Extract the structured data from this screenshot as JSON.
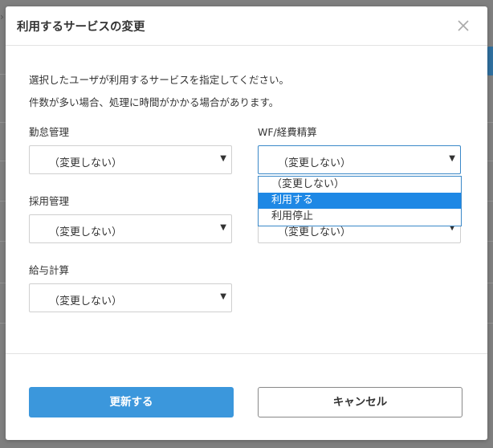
{
  "dialog": {
    "title": "利用するサービスの変更",
    "description_line1": "選択したユーザが利用するサービスを指定してください。",
    "description_line2": "件数が多い場合、処理に時間がかかる場合があります。"
  },
  "fields": {
    "attendance": {
      "label": "勤怠管理",
      "value": "（変更しない）"
    },
    "recruitment": {
      "label": "採用管理",
      "value": "（変更しない）"
    },
    "payroll": {
      "label": "給与計算",
      "value": "（変更しない）"
    },
    "wf_expense": {
      "label": "WF/経費精算",
      "value": "（変更しない）"
    },
    "behind_dropdown": {
      "value": "（変更しない）"
    }
  },
  "dropdown": {
    "options": [
      "（変更しない）",
      "利用する",
      "利用停止"
    ],
    "highlighted_index": 1,
    "highlight_color": "#1e88e5"
  },
  "buttons": {
    "update_label": "更新する",
    "cancel_label": "キャンセル",
    "primary_color": "#3b97dc"
  },
  "icons": {
    "close": "close-icon",
    "select_arrow": "caret-down-icon"
  }
}
